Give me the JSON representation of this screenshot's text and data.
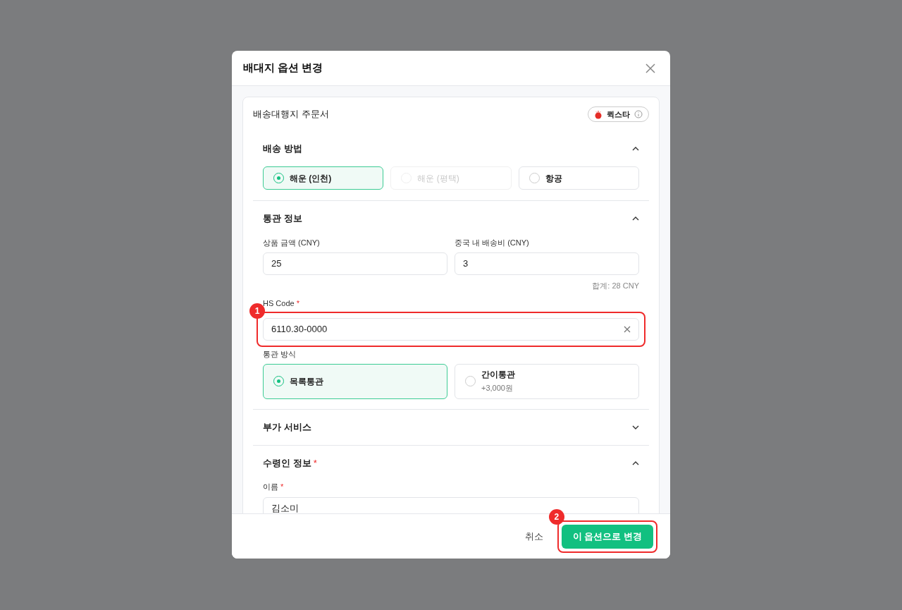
{
  "dialog": {
    "title": "배대지 옵션 변경"
  },
  "order_card": {
    "title": "배송대행지 주문서",
    "provider": "퀵스타"
  },
  "sections": [
    {
      "kind": "shipping",
      "title": "배송 방법",
      "expanded": true,
      "options": [
        {
          "label": "해운 (인천)",
          "selected": true,
          "disabled": false
        },
        {
          "label": "해운 (평택)",
          "selected": false,
          "disabled": true
        },
        {
          "label": "항공",
          "selected": false,
          "disabled": false
        }
      ]
    },
    {
      "kind": "customs",
      "title": "통관 정보",
      "expanded": true,
      "fields": [
        {
          "label": "상품 금액 (CNY)",
          "value": "25"
        },
        {
          "label": "중국 내 배송비 (CNY)",
          "value": "3"
        }
      ],
      "total": "합계: 28 CNY",
      "hs_code": {
        "label": "HS Code",
        "required_mark": "*",
        "value": "6110.30-0000",
        "annotation": "1"
      },
      "method_label": "통관 방식",
      "methods": [
        {
          "label": "목록통관",
          "selected": true
        },
        {
          "label": "간이통관",
          "note": "+3,000원",
          "selected": false
        }
      ]
    },
    {
      "kind": "extras",
      "title": "부가 서비스",
      "expanded": false
    },
    {
      "kind": "recipient",
      "title": "수령인 정보",
      "required_mark": "*",
      "expanded": true,
      "fields": [
        {
          "label": "이름",
          "required_mark": "*",
          "value": "김소미"
        }
      ]
    }
  ],
  "footer": {
    "cancel": "취소",
    "confirm": {
      "label": "이 옵션으로 변경",
      "annotation": "2"
    }
  }
}
